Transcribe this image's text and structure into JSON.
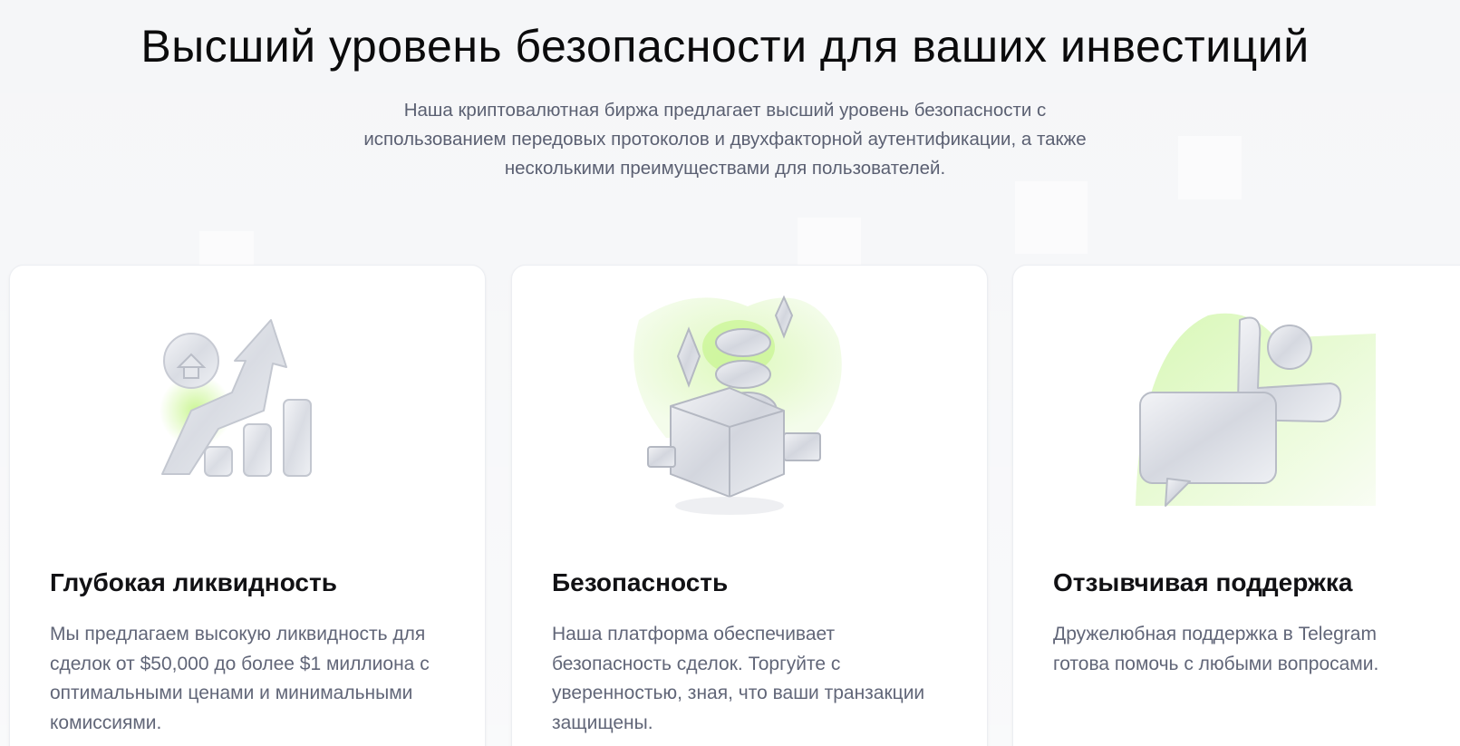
{
  "header": {
    "title": "Высший уровень безопасности для ваших инвестиций",
    "subtitle": "Наша криптовалютная биржа предлагает высший уровень безопасности с использованием передовых протоколов и двухфакторной аутентификации, а также несколькими преимуществами для пользователей."
  },
  "colors": {
    "accent_green": "#b8f27a",
    "text_dark": "#111114",
    "text_muted": "#616678",
    "card_bg": "#ffffff",
    "page_bg": "#f5f6f8"
  },
  "features": [
    {
      "icon": "growth-chart-icon",
      "title": "Глубокая ликвидность",
      "text": "Мы предлагаем высокую ликвидность для сделок от $50,000 до более $1 миллиона с оптимальными ценами и минимальными комиссиями."
    },
    {
      "icon": "secure-box-icon",
      "title": "Безопасность",
      "text": "Наша платформа обеспечивает безопасность сделок. Торгуйте с уверенностью, зная, что ваши транзакции защищены."
    },
    {
      "icon": "support-chat-icon",
      "title": "Отзывчивая поддержка",
      "text": "Дружелюбная поддержка в Telegram готова помочь с любыми вопросами."
    }
  ]
}
